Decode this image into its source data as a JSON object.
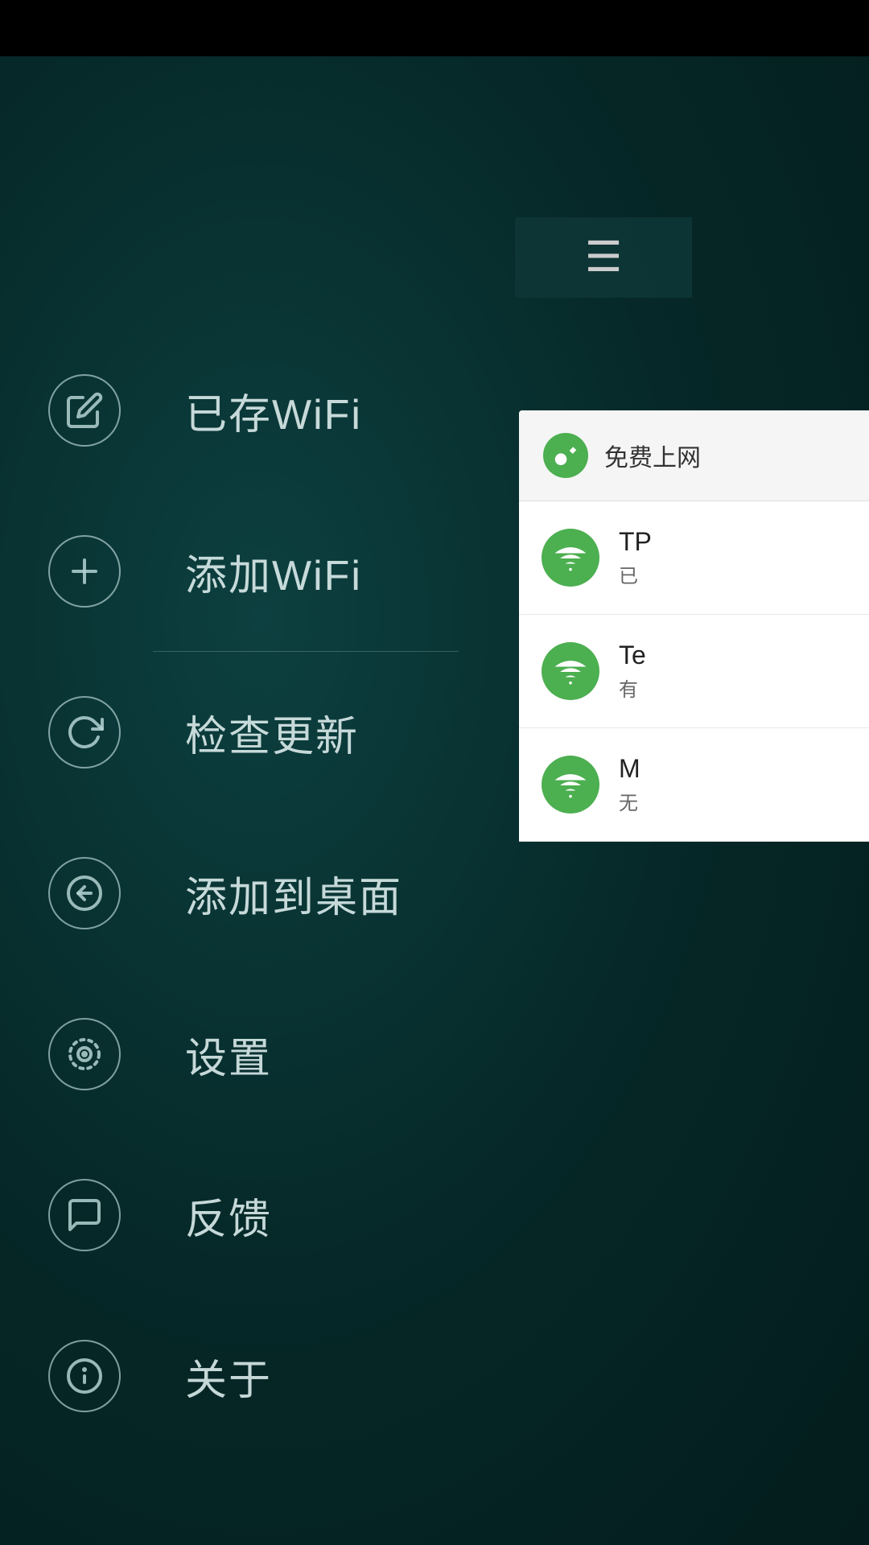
{
  "statusBar": {
    "bg": "#000000"
  },
  "header": {
    "hamburger": "☰"
  },
  "menu": {
    "items": [
      {
        "id": "saved-wifi",
        "label": "已存WiFi",
        "icon": "edit",
        "hasDivider": false
      },
      {
        "id": "add-wifi",
        "label": "添加WiFi",
        "icon": "plus",
        "hasDivider": true
      },
      {
        "id": "check-update",
        "label": "检查更新",
        "icon": "refresh",
        "hasDivider": false
      },
      {
        "id": "add-desktop",
        "label": "添加到桌面",
        "icon": "add-desktop",
        "hasDivider": false
      },
      {
        "id": "settings",
        "label": "设置",
        "icon": "settings",
        "hasDivider": false
      },
      {
        "id": "feedback",
        "label": "反馈",
        "icon": "feedback",
        "hasDivider": false
      },
      {
        "id": "about",
        "label": "关于",
        "icon": "info",
        "hasDivider": false
      }
    ]
  },
  "wifiPanel": {
    "header": {
      "title": "免费上网"
    },
    "items": [
      {
        "name": "TP",
        "status": "已",
        "connected": true
      },
      {
        "name": "Te",
        "status": "有",
        "connected": true
      },
      {
        "name": "M",
        "status": "无",
        "connected": true
      }
    ]
  }
}
